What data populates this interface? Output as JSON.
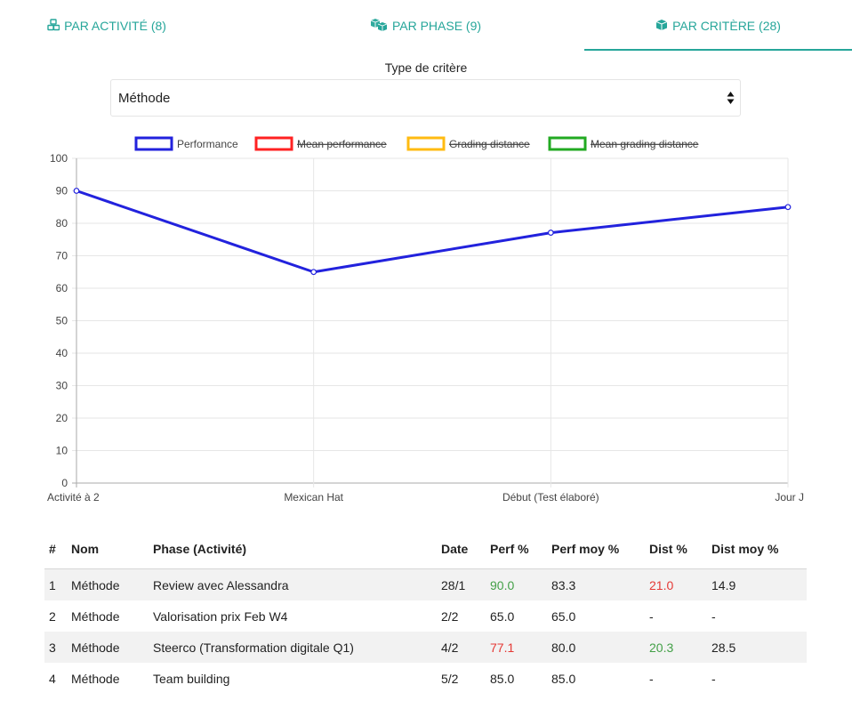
{
  "tabs": [
    {
      "label": "PAR ACTIVITÉ (8)",
      "icon": "cubes-icon"
    },
    {
      "label": "PAR PHASE (9)",
      "icon": "boxes-icon"
    },
    {
      "label": "PAR CRITÈRE (28)",
      "icon": "cube-icon",
      "active": true
    }
  ],
  "filter": {
    "label": "Type de critère",
    "selected": "Méthode"
  },
  "colors": {
    "accent": "#26a69a",
    "performance": "#2222dd",
    "mean_performance": "#ff2222",
    "grading_distance": "#ffbb11",
    "mean_grading_distance": "#22aa22"
  },
  "chart_data": {
    "type": "line",
    "categories": [
      "Activité à 2",
      "Mexican Hat",
      "Début (Test élaboré)",
      "Jour J"
    ],
    "series": [
      {
        "name": "Performance",
        "values": [
          90,
          65,
          77.1,
          85
        ],
        "visible": true
      },
      {
        "name": "Mean performance",
        "values": [],
        "visible": false
      },
      {
        "name": "Grading distance",
        "values": [],
        "visible": false
      },
      {
        "name": "Mean grading distance",
        "values": [],
        "visible": false
      }
    ],
    "ylim": [
      0,
      100
    ],
    "yticks": [
      0,
      10,
      20,
      30,
      40,
      50,
      60,
      70,
      80,
      90,
      100
    ],
    "grid": true,
    "legend": "top"
  },
  "table": {
    "headers": [
      "#",
      "Nom",
      "Phase (Activité)",
      "Date",
      "Perf %",
      "Perf moy %",
      "Dist %",
      "Dist moy %"
    ],
    "rows": [
      {
        "num": "1",
        "nom": "Méthode",
        "phase": "Review avec Alessandra",
        "date": "28/1",
        "perf": "90.0",
        "perf_status": "green",
        "perf_moy": "83.3",
        "dist": "21.0",
        "dist_status": "red",
        "dist_moy": "14.9"
      },
      {
        "num": "2",
        "nom": "Méthode",
        "phase": "Valorisation prix Feb W4",
        "date": "2/2",
        "perf": "65.0",
        "perf_status": "",
        "perf_moy": "65.0",
        "dist": "-",
        "dist_status": "",
        "dist_moy": "-"
      },
      {
        "num": "3",
        "nom": "Méthode",
        "phase": "Steerco (Transformation digitale Q1)",
        "date": "4/2",
        "perf": "77.1",
        "perf_status": "red",
        "perf_moy": "80.0",
        "dist": "20.3",
        "dist_status": "green",
        "dist_moy": "28.5"
      },
      {
        "num": "4",
        "nom": "Méthode",
        "phase": "Team building",
        "date": "5/2",
        "perf": "85.0",
        "perf_status": "",
        "perf_moy": "85.0",
        "dist": "-",
        "dist_status": "",
        "dist_moy": "-"
      }
    ]
  }
}
